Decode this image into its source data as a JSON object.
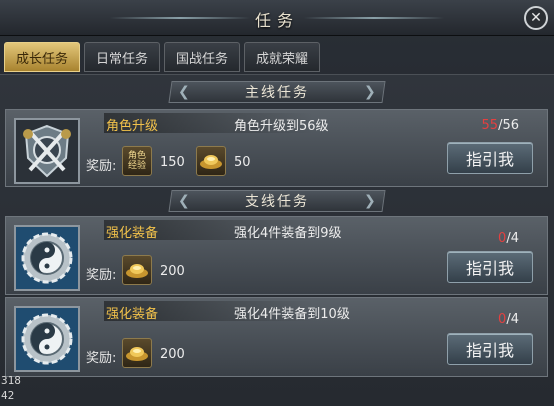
{
  "window": {
    "title": "任务",
    "close_icon": "close-icon"
  },
  "tabs": [
    {
      "label": "成长任务",
      "active": true
    },
    {
      "label": "日常任务",
      "active": false
    },
    {
      "label": "国战任务",
      "active": false
    },
    {
      "label": "成就荣耀",
      "active": false
    }
  ],
  "sections": {
    "main": "主线任务",
    "side": "支线任务"
  },
  "quests": [
    {
      "icon": "crossed-swords-crest-icon",
      "name": "角色升级",
      "desc": "角色升级到56级",
      "reward_label": "奖励:",
      "rewards": [
        {
          "icon": "exp-book-icon",
          "icon_text": "角色经验",
          "value": "150"
        },
        {
          "icon": "gold-ingot-icon",
          "value": "50"
        }
      ],
      "progress_current": "55",
      "progress_sep": "/",
      "progress_total": "56",
      "button": "指引我"
    },
    {
      "icon": "gear-yinyang-icon",
      "name": "强化装备",
      "desc": "强化4件装备到9级",
      "reward_label": "奖励:",
      "rewards": [
        {
          "icon": "gold-ingot-icon",
          "value": "200"
        }
      ],
      "progress_current": "0",
      "progress_sep": "/",
      "progress_total": "4",
      "button": "指引我"
    },
    {
      "icon": "gear-yinyang-icon",
      "name": "强化装备",
      "desc": "强化4件装备到10级",
      "reward_label": "奖励:",
      "rewards": [
        {
          "icon": "gold-ingot-icon",
          "value": "200"
        }
      ],
      "progress_current": "0",
      "progress_sep": "/",
      "progress_total": "4",
      "button": "指引我"
    }
  ],
  "corner": {
    "line1": "318",
    "line2": "42"
  },
  "colors": {
    "accent_gold": "#f2c24b",
    "progress_red": "#e44040",
    "tab_active": "#e3c77a"
  }
}
